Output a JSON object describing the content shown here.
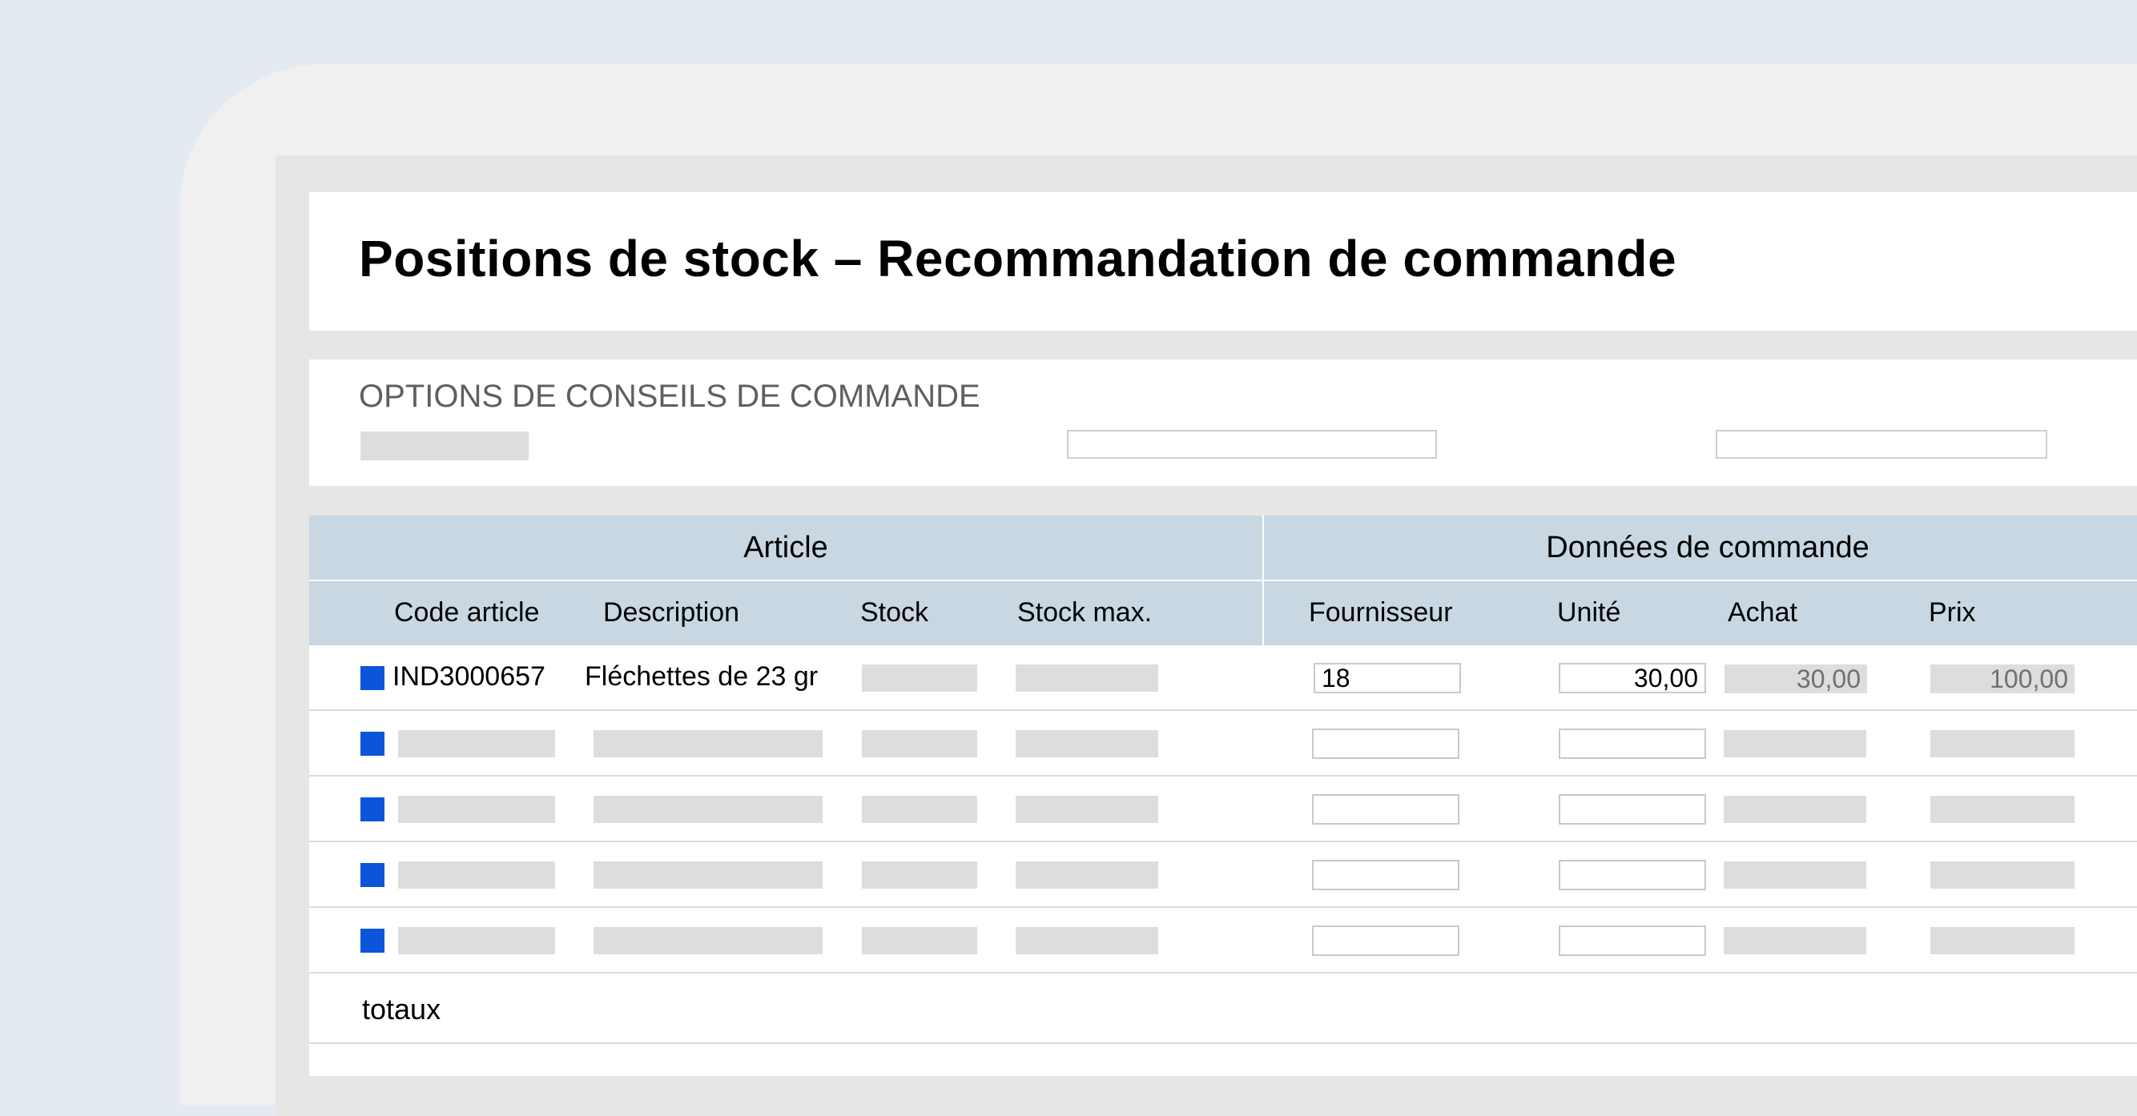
{
  "page": {
    "title": "Positions de stock – Recommandation de commande"
  },
  "options": {
    "title": "OPTIONS DE CONSEILS DE COMMANDE"
  },
  "table": {
    "group_headers": {
      "article": "Article",
      "order_data": "Données de commande"
    },
    "columns": {
      "code": "Code article",
      "description": "Description",
      "stock": "Stock",
      "stock_max": "Stock max.",
      "supplier": "Fournisseur",
      "unit": "Unité",
      "purchase": "Achat",
      "price": "Prix"
    },
    "first_row": {
      "code": "IND3000657",
      "description": "Fléchettes de 23 gr",
      "supplier": "18",
      "unit": "30,00",
      "purchase": "30,00",
      "price": "100,00"
    },
    "totals_label": "totaux"
  },
  "colors": {
    "background": "#e3eaf1",
    "header_bg": "#c8d7e1",
    "row_marker": "#0b55d9",
    "placeholder": "#dddddd"
  },
  "icons": {
    "row_marker": "blue-square-icon"
  }
}
